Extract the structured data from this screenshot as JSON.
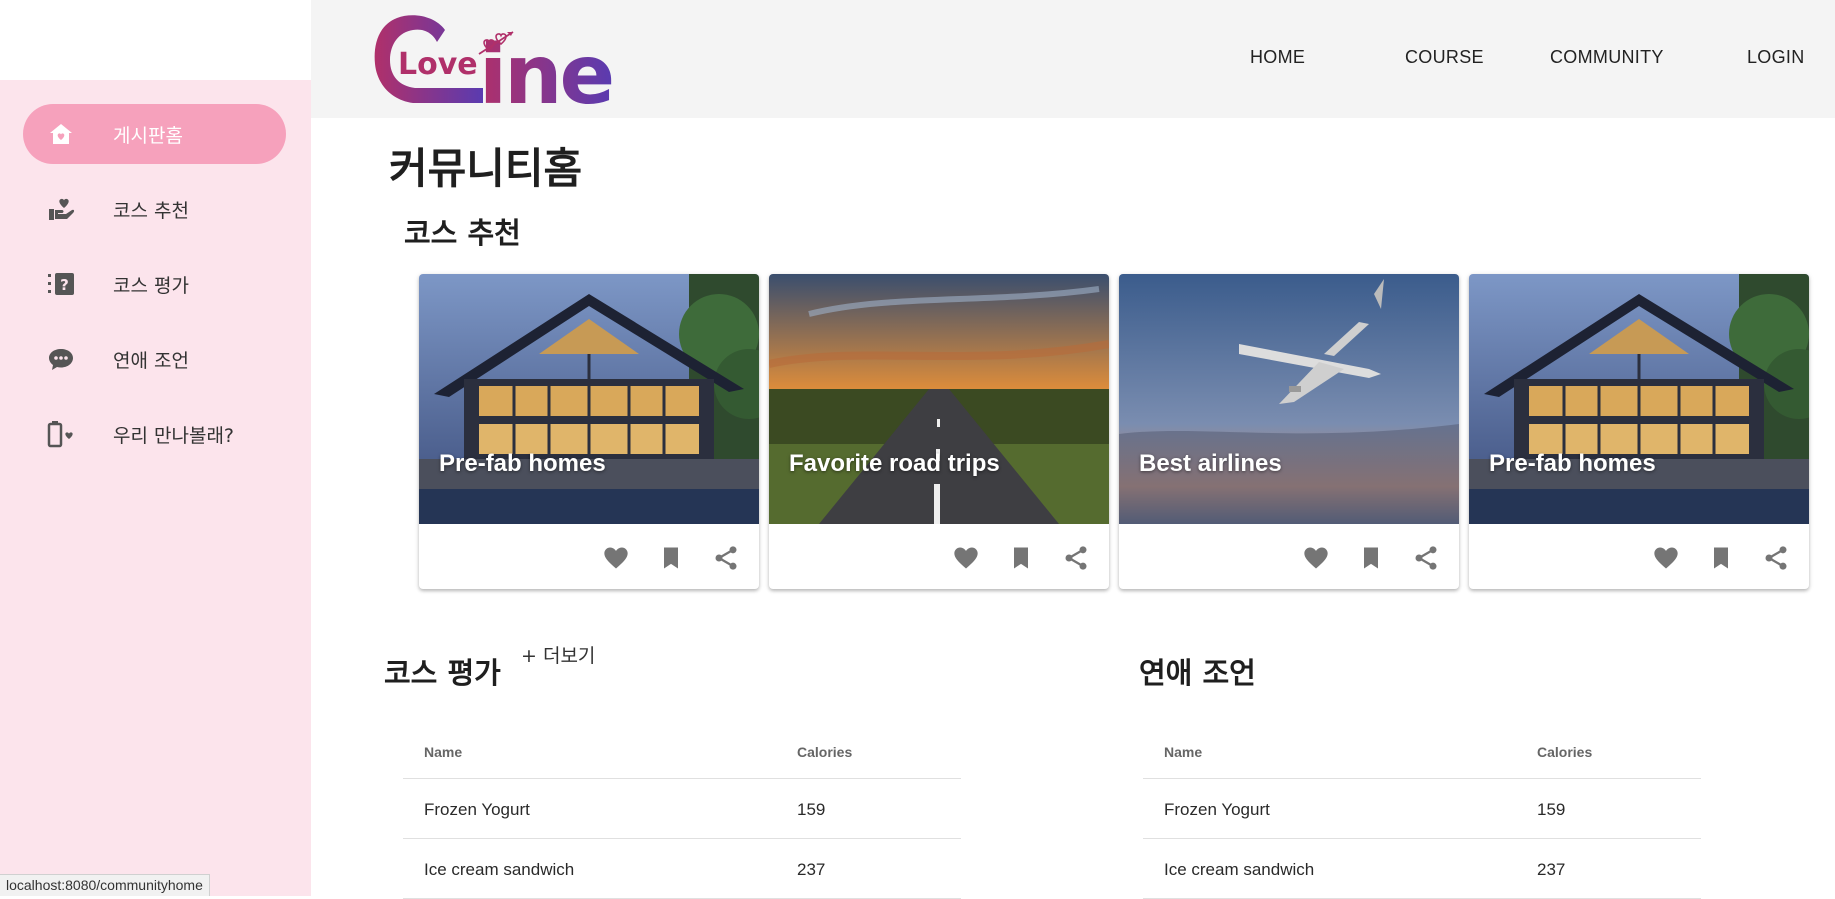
{
  "logo": {
    "text_love": "Love",
    "text_ine": "ine"
  },
  "nav": [
    {
      "label": "HOME"
    },
    {
      "label": "COURSE"
    },
    {
      "label": "COMMUNITY"
    },
    {
      "label": "LOGIN"
    }
  ],
  "sidebar": {
    "items": [
      {
        "label": "게시판홈",
        "icon": "house-heart-icon",
        "active": true
      },
      {
        "label": "코스 추천",
        "icon": "hand-heart-icon",
        "active": false
      },
      {
        "label": "코스 평가",
        "icon": "question-box-icon",
        "active": false
      },
      {
        "label": "연애 조언",
        "icon": "chat-bubble-icon",
        "active": false
      },
      {
        "label": "우리 만나볼래?",
        "icon": "battery-heart-icon",
        "active": false
      }
    ]
  },
  "main": {
    "title": "커뮤니티홈",
    "recommend": {
      "title": "코스 추천",
      "cards": [
        {
          "title": "Pre-fab homes",
          "image": "house"
        },
        {
          "title": "Favorite road trips",
          "image": "road"
        },
        {
          "title": "Best airlines",
          "image": "plane"
        },
        {
          "title": "Pre-fab homes",
          "image": "house"
        }
      ]
    },
    "review": {
      "title": "코스 평가",
      "more": "+ 더보기",
      "columns": [
        "Name",
        "Calories"
      ],
      "rows": [
        [
          "Frozen Yogurt",
          "159"
        ],
        [
          "Ice cream sandwich",
          "237"
        ]
      ]
    },
    "advice": {
      "title": "연애 조언",
      "columns": [
        "Name",
        "Calories"
      ],
      "rows": [
        [
          "Frozen Yogurt",
          "159"
        ],
        [
          "Ice cream sandwich",
          "237"
        ]
      ]
    }
  },
  "status_bar": {
    "url": "localhost:8080/communityhome"
  },
  "colors": {
    "sidebar_bg": "#fce4ec",
    "sidebar_active": "#f6a1bc",
    "header_bg": "#f4f4f4",
    "logo_gradient_start": "#b0306a",
    "logo_gradient_end": "#5a3bb0"
  }
}
